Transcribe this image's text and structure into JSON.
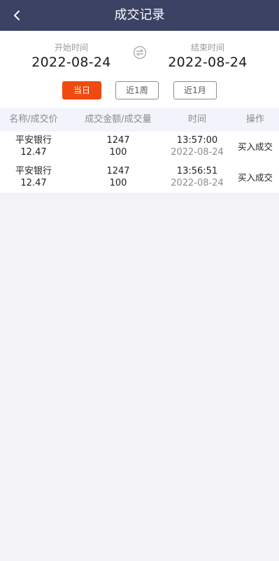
{
  "header": {
    "title": "成交记录",
    "back_icon": "chevron-left-icon"
  },
  "range": {
    "start_label": "开始时间",
    "start_value": "2022-08-24",
    "end_label": "结束时间",
    "end_value": "2022-08-24",
    "swap_icon": "swap-icon"
  },
  "filters": [
    {
      "label": "当日",
      "active": true
    },
    {
      "label": "近1周",
      "active": false
    },
    {
      "label": "近1月",
      "active": false
    }
  ],
  "table": {
    "headers": [
      "名称/成交价",
      "成交金额/成交量",
      "时间",
      "操作"
    ],
    "rows": [
      {
        "name": "平安银行",
        "price": "12.47",
        "amount": "1247",
        "volume": "100",
        "time": "13:57:00",
        "date": "2022-08-24",
        "action": "买入成交"
      },
      {
        "name": "平安银行",
        "price": "12.47",
        "amount": "1247",
        "volume": "100",
        "time": "13:56:51",
        "date": "2022-08-24",
        "action": "买入成交"
      }
    ]
  },
  "colors": {
    "nav_bg": "#3b4263",
    "accent": "#f04a10",
    "header_row_bg": "#f2f4fb",
    "page_bg": "#f3f2f6"
  }
}
